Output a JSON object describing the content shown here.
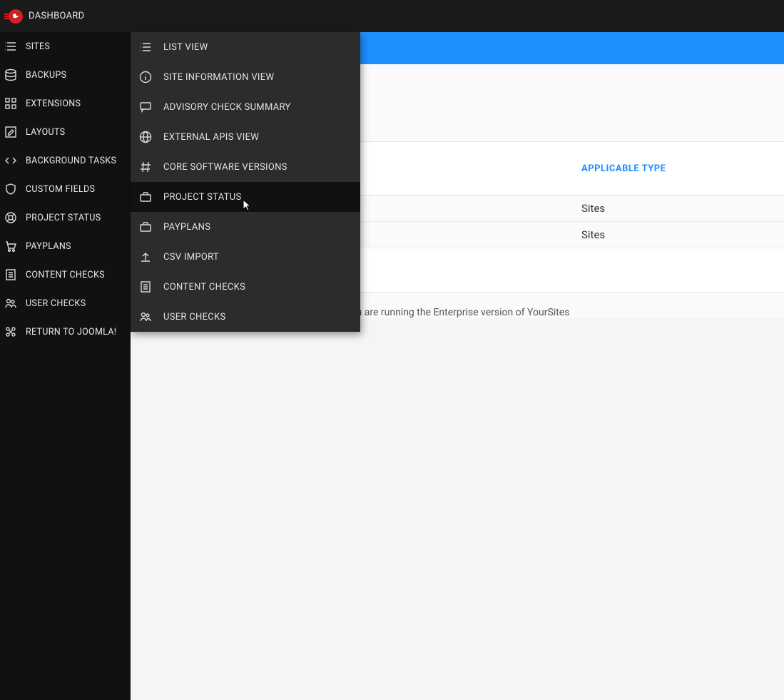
{
  "topbar": {
    "title": "DASHBOARD"
  },
  "sidebar": {
    "items": [
      {
        "label": "SITES",
        "icon": "list-icon"
      },
      {
        "label": "BACKUPS",
        "icon": "database-icon"
      },
      {
        "label": "EXTENSIONS",
        "icon": "grid-icon"
      },
      {
        "label": "LAYOUTS",
        "icon": "edit-icon"
      },
      {
        "label": "BACKGROUND TASKS",
        "icon": "code-icon"
      },
      {
        "label": "CUSTOM FIELDS",
        "icon": "shield-icon"
      },
      {
        "label": "PROJECT STATUS",
        "icon": "lifebuoy-icon"
      },
      {
        "label": "PAYPLANS",
        "icon": "cart-icon"
      },
      {
        "label": "CONTENT CHECKS",
        "icon": "document-icon"
      },
      {
        "label": "USER CHECKS",
        "icon": "users-icon"
      },
      {
        "label": "RETURN TO JOOMLA!",
        "icon": "joomla-icon"
      }
    ]
  },
  "submenu": {
    "items": [
      {
        "label": "LIST VIEW",
        "icon": "list-icon",
        "active": false
      },
      {
        "label": "SITE INFORMATION VIEW",
        "icon": "info-icon",
        "active": false
      },
      {
        "label": "ADVISORY CHECK SUMMARY",
        "icon": "chat-icon",
        "active": false
      },
      {
        "label": "EXTERNAL APIS VIEW",
        "icon": "globe-icon",
        "active": false
      },
      {
        "label": "CORE SOFTWARE VERSIONS",
        "icon": "hash-icon",
        "active": false
      },
      {
        "label": "PROJECT STATUS",
        "icon": "briefcase-icon",
        "active": true
      },
      {
        "label": "PAYPLANS",
        "icon": "briefcase-icon",
        "active": false
      },
      {
        "label": "CSV IMPORT",
        "icon": "upload-icon",
        "active": false
      },
      {
        "label": "CONTENT CHECKS",
        "icon": "document-icon",
        "active": false
      },
      {
        "label": "USER CHECKS",
        "icon": "users-icon",
        "active": false
      }
    ]
  },
  "table": {
    "header_type": "APPLICABLE TYPE",
    "rows": [
      {
        "type": "Sites"
      },
      {
        "type": "Sites"
      }
    ]
  },
  "footer_note": "You are running the Enterprise version of YourSites"
}
